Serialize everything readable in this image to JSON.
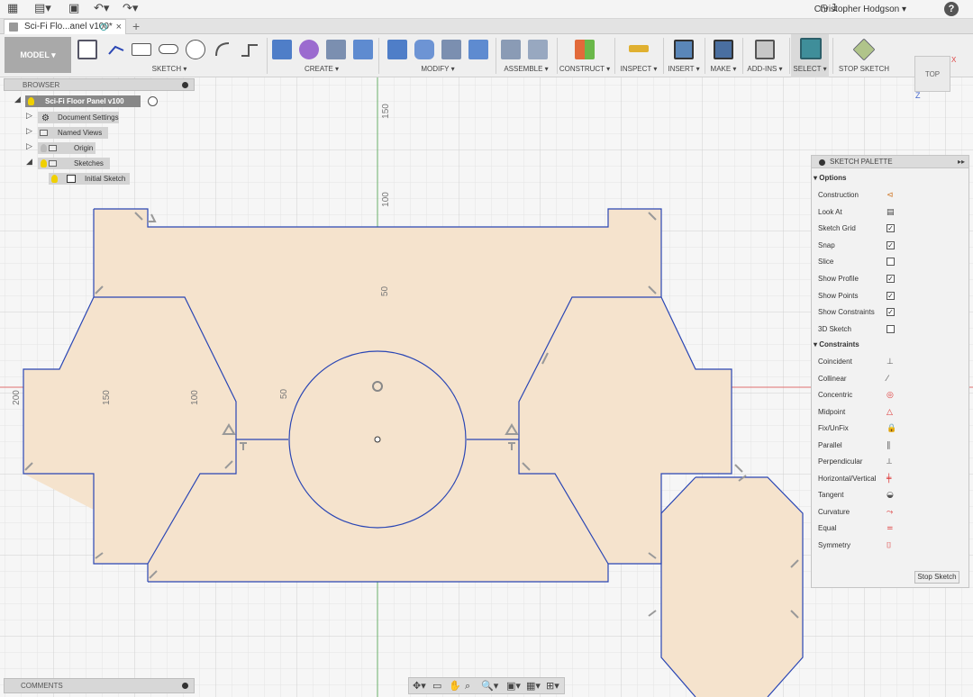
{
  "app": {
    "tab_title": "Sci-Fi Flo...anel v100*",
    "user_name": "Christopher Hodgson ▾",
    "job_count": "1",
    "help_label": "?"
  },
  "toolbar": {
    "model_label": "MODEL ▾",
    "groups": [
      {
        "label": "SKETCH ▾"
      },
      {
        "label": "CREATE ▾"
      },
      {
        "label": "MODIFY ▾"
      },
      {
        "label": "ASSEMBLE ▾"
      },
      {
        "label": "CONSTRUCT ▾"
      },
      {
        "label": "INSPECT ▾"
      },
      {
        "label": "INSERT ▾"
      },
      {
        "label": "MAKE ▾"
      },
      {
        "label": "ADD-INS ▾"
      },
      {
        "label": "SELECT ▾"
      },
      {
        "label": "STOP SKETCH"
      }
    ]
  },
  "browser": {
    "title": "BROWSER",
    "root": "Sci-Fi Floor Panel v100",
    "items": [
      {
        "label": "Document Settings"
      },
      {
        "label": "Named Views"
      },
      {
        "label": "Origin"
      },
      {
        "label": "Sketches"
      },
      {
        "label": "Initial Sketch"
      }
    ]
  },
  "canvas": {
    "axis_labels": {
      "y150": "150",
      "y100": "100",
      "y50": "50",
      "x200": "200",
      "x150": "150",
      "x100": "100",
      "x50": "50"
    },
    "colors": {
      "profile_fill": "#f5e3cd",
      "sketch_line": "#2a46b4",
      "x_axis": "#e07070",
      "y_axis": "#6ab06a"
    }
  },
  "viewcube": {
    "face": "TOP",
    "x": "X",
    "z": "Z"
  },
  "palette": {
    "title": "SKETCH PALETTE",
    "options_header": "▾ Options",
    "options": [
      {
        "label": "Construction",
        "type": "icon",
        "icon": "construction-icon"
      },
      {
        "label": "Look At",
        "type": "icon",
        "icon": "look-at-icon"
      },
      {
        "label": "Sketch Grid",
        "type": "check",
        "checked": "✓"
      },
      {
        "label": "Snap",
        "type": "check",
        "checked": "✓"
      },
      {
        "label": "Slice",
        "type": "check",
        "checked": ""
      },
      {
        "label": "Show Profile",
        "type": "check",
        "checked": "✓"
      },
      {
        "label": "Show Points",
        "type": "check",
        "checked": "✓"
      },
      {
        "label": "Show Constraints",
        "type": "check",
        "checked": "✓"
      },
      {
        "label": "3D Sketch",
        "type": "check",
        "checked": ""
      }
    ],
    "constraints_header": "▾ Constraints",
    "constraints": [
      {
        "label": "Coincident",
        "icon": "coincident-icon",
        "glyph": "⊥"
      },
      {
        "label": "Collinear",
        "icon": "collinear-icon",
        "glyph": "⁄"
      },
      {
        "label": "Concentric",
        "icon": "concentric-icon",
        "glyph": "◎"
      },
      {
        "label": "Midpoint",
        "icon": "midpoint-icon",
        "glyph": "△"
      },
      {
        "label": "Fix/UnFix",
        "icon": "lock-icon",
        "glyph": "🔒"
      },
      {
        "label": "Parallel",
        "icon": "parallel-icon",
        "glyph": "∥"
      },
      {
        "label": "Perpendicular",
        "icon": "perpendicular-icon",
        "glyph": "⟂"
      },
      {
        "label": "Horizontal/Vertical",
        "icon": "horizontal-vertical-icon",
        "glyph": "╪"
      },
      {
        "label": "Tangent",
        "icon": "tangent-icon",
        "glyph": "◒"
      },
      {
        "label": "Curvature",
        "icon": "curvature-icon",
        "glyph": "⤳"
      },
      {
        "label": "Equal",
        "icon": "equal-icon",
        "glyph": "="
      },
      {
        "label": "Symmetry",
        "icon": "symmetry-icon",
        "glyph": "⌷"
      }
    ],
    "stop_sketch": "Stop Sketch"
  },
  "comments": {
    "title": "COMMENTS"
  }
}
